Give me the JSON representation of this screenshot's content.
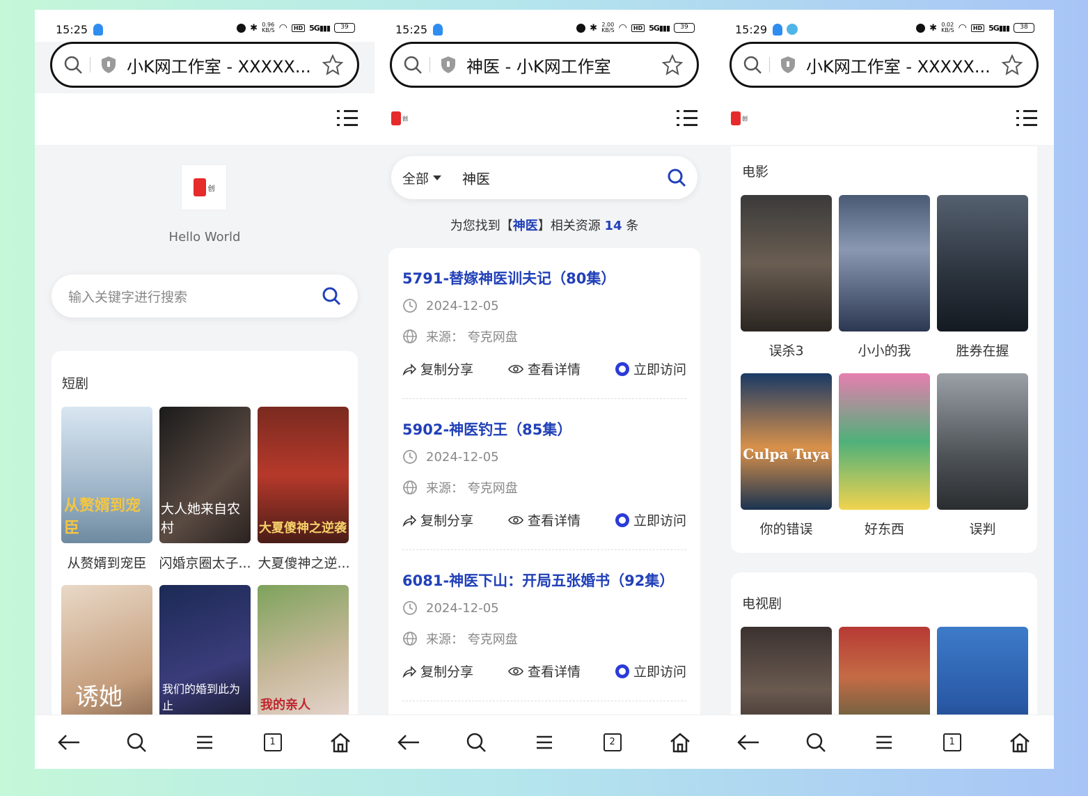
{
  "colors": {
    "accent": "#2140b8",
    "brand_red": "#e52b2b"
  },
  "phones": [
    {
      "status": {
        "time": "15:25",
        "speed": "0.96\nKB/S",
        "battery": "39"
      },
      "url_title": "小K网工作室 - XXXXX...",
      "tab_count": "1"
    },
    {
      "status": {
        "time": "15:25",
        "speed": "2.00\nKB/S",
        "battery": "39"
      },
      "url_title": "神医 - 小K网工作室",
      "tab_count": "2"
    },
    {
      "status": {
        "time": "15:29",
        "speed": "0.02\nKB/S",
        "battery": "38"
      },
      "url_title": "小K网工作室 - XXXXX...",
      "tab_count": "1"
    }
  ],
  "home": {
    "hello": "Hello World",
    "search_placeholder": "输入关键字进行搜索",
    "short_drama": {
      "title": "短剧",
      "items": [
        {
          "caption": "从赘婿到宠臣",
          "poster_text": "从赘婿到宠臣"
        },
        {
          "caption": "闪婚京圈太子...",
          "poster_text": "大人她来自农村"
        },
        {
          "caption": "大夏傻神之逆...",
          "poster_text": "大夏傻神之逆袭"
        },
        {
          "caption": "",
          "poster_text": "诱她"
        },
        {
          "caption": "",
          "poster_text": "我们的婚到此为止"
        },
        {
          "caption": "",
          "poster_text": "我的亲人"
        }
      ]
    }
  },
  "search": {
    "scope": "全部",
    "query": "神医",
    "found_prefix": "为您找到【",
    "found_keyword": "神医",
    "found_mid": "】相关资源 ",
    "found_count": "14",
    "found_suffix": " 条",
    "results": [
      {
        "title": "5791-替嫁神医训夫记（80集）",
        "date": "2024-12-05",
        "source": "来源：  夸克网盘"
      },
      {
        "title": "5902-神医钓王（85集）",
        "date": "2024-12-05",
        "source": "来源：  夸克网盘"
      },
      {
        "title": "6081-神医下山：开局五张婚书（92集）",
        "date": "2024-12-05",
        "source": "来源：  夸克网盘"
      }
    ],
    "actions": {
      "share": "复制分享",
      "details": "查看详情",
      "visit": "立即访问"
    }
  },
  "categories": {
    "movies": {
      "title": "电影",
      "items": [
        {
          "caption": "误杀3"
        },
        {
          "caption": "小小的我"
        },
        {
          "caption": "胜券在握"
        },
        {
          "caption": "你的错误",
          "poster_text": "Culpa Tuya"
        },
        {
          "caption": "好东西"
        },
        {
          "caption": "误判"
        }
      ]
    },
    "tv": {
      "title": "电视剧"
    }
  }
}
